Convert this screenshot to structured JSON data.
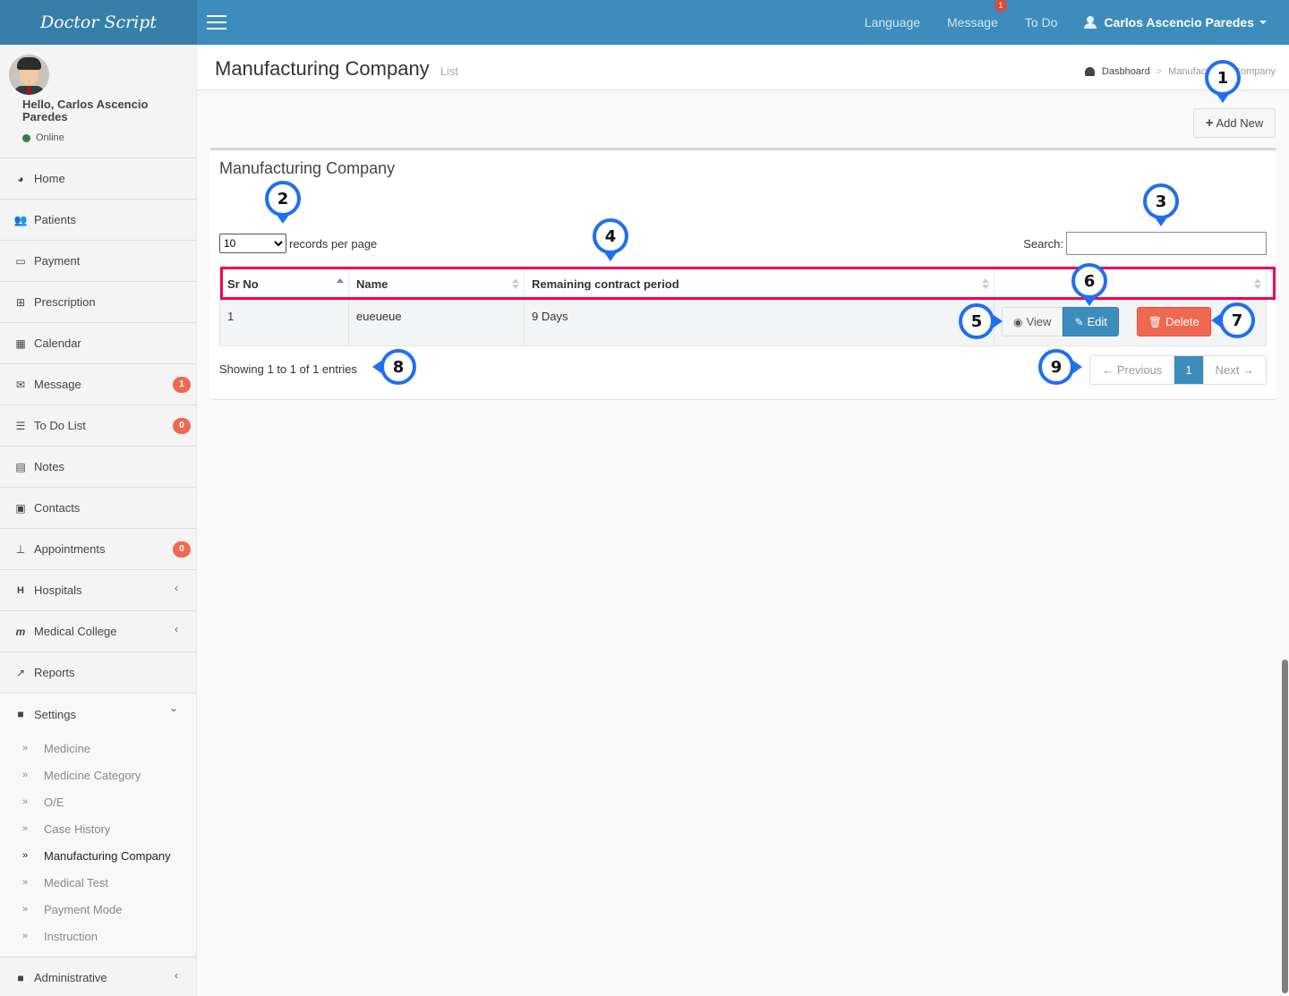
{
  "app": {
    "brand": "Doctor Script"
  },
  "topnav": {
    "language": "Language",
    "message": "Message",
    "message_badge": "1",
    "todo": "To Do",
    "user": "Carlos Ascencio Paredes"
  },
  "sidebar": {
    "greeting": "Hello, Carlos Ascencio Paredes",
    "status": "Online",
    "items": [
      {
        "label": "Home",
        "icon": "dashboard-icon",
        "glyph": "◕"
      },
      {
        "label": "Patients",
        "icon": "users-icon",
        "glyph": "👥"
      },
      {
        "label": "Payment",
        "icon": "credit-card-icon",
        "glyph": "▭"
      },
      {
        "label": "Prescription",
        "icon": "medkit-icon",
        "glyph": "⊞"
      },
      {
        "label": "Calendar",
        "icon": "calendar-icon",
        "glyph": "▦"
      },
      {
        "label": "Message",
        "icon": "envelope-icon",
        "glyph": "✉",
        "badge": "1"
      },
      {
        "label": "To Do List",
        "icon": "list-icon",
        "glyph": "☰",
        "badge": "0"
      },
      {
        "label": "Notes",
        "icon": "file-text-icon",
        "glyph": "▤"
      },
      {
        "label": "Contacts",
        "icon": "address-card-icon",
        "glyph": "▣"
      },
      {
        "label": "Appointments",
        "icon": "thumbtack-icon",
        "glyph": "⊥",
        "badge": "0"
      },
      {
        "label": "Hospitals",
        "icon": "hospital-icon",
        "glyph": "H"
      },
      {
        "label": "Medical College",
        "icon": "medical-college-icon",
        "glyph": "m"
      },
      {
        "label": "Reports",
        "icon": "line-chart-icon",
        "glyph": "↗"
      },
      {
        "label": "Settings",
        "icon": "folder-icon",
        "glyph": "■"
      },
      {
        "label": "Administrative",
        "icon": "folder-icon",
        "glyph": "■"
      }
    ],
    "settings_sub": [
      "Medicine",
      "Medicine Category",
      "O/E",
      "Case History",
      "Manufacturing Company",
      "Medical Test",
      "Payment Mode",
      "Instruction"
    ],
    "active_sub": "Manufacturing Company"
  },
  "header": {
    "title": "Manufacturing Company",
    "subtitle": "List",
    "breadcrumb_home": "Dasbhoard",
    "breadcrumb_sep": ">",
    "breadcrumb_current": "Manufacturing Company"
  },
  "toolbar": {
    "add_new": "Add New"
  },
  "box": {
    "title": "Manufacturing Company",
    "length_value": "10",
    "length_options": [
      "10"
    ],
    "length_label": "records per page",
    "search_label": "Search:",
    "search_value": "",
    "columns": [
      "Sr No",
      "Name",
      "Remaining contract period",
      ""
    ],
    "rows": [
      {
        "sr": "1",
        "name": "eueueue",
        "remaining": "9 Days"
      }
    ],
    "view_label": "View",
    "edit_label": "Edit",
    "delete_label": "Delete",
    "info": "Showing 1 to 1 of 1 entries",
    "pagination": {
      "previous": "← Previous",
      "current": "1",
      "next": "Next →"
    }
  },
  "annotations": [
    "1",
    "2",
    "3",
    "4",
    "5",
    "6",
    "7",
    "8",
    "9"
  ],
  "colors": {
    "topbar": "#3c8dbc",
    "brand_bg": "#367fa9",
    "badge": "#ef6950",
    "edit": "#3c8dbc",
    "delete": "#ef6950",
    "highlight": "#f2004f",
    "marker": "#1f6ff0"
  }
}
